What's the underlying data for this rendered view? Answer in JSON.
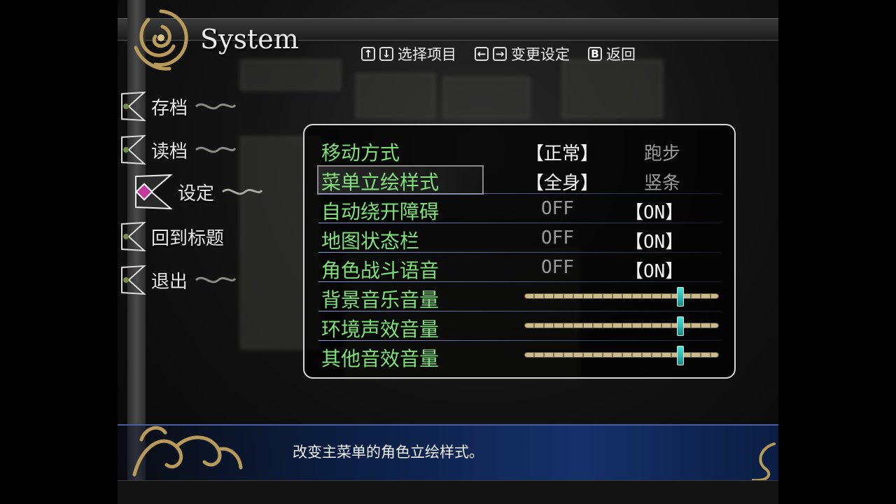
{
  "header": {
    "title": "System",
    "hints": {
      "up_key": "↑",
      "down_key": "↓",
      "select_label": "选择项目",
      "left_key": "←",
      "right_key": "→",
      "change_label": "变更设定",
      "back_key": "B",
      "back_label": "返回"
    }
  },
  "menu": {
    "items": [
      {
        "label": "存档"
      },
      {
        "label": "读档"
      },
      {
        "label": "设定",
        "selected": true
      },
      {
        "label": "回到标题"
      },
      {
        "label": "退出"
      }
    ]
  },
  "settings": {
    "rows": [
      {
        "label": "移动方式",
        "opt1": "【正常】",
        "opt2": "跑步",
        "active": "opt1"
      },
      {
        "label": "菜单立绘样式",
        "opt1": "【全身】",
        "opt2": "竖条",
        "active": "opt1",
        "selected": true
      },
      {
        "label": "自动绕开障碍",
        "opt1": "OFF",
        "opt2": "【ON】",
        "active": "opt2"
      },
      {
        "label": "地图状态栏",
        "opt1": "OFF",
        "opt2": "【ON】",
        "active": "opt2"
      },
      {
        "label": "角色战斗语音",
        "opt1": "OFF",
        "opt2": "【ON】",
        "active": "opt2"
      },
      {
        "label": "背景音乐音量",
        "slider": 0.8
      },
      {
        "label": "环境声效音量",
        "slider": 0.8
      },
      {
        "label": "其他音效音量",
        "slider": 0.8
      }
    ]
  },
  "footer": {
    "description": "改变主菜单的角色立绘样式。"
  },
  "colors": {
    "label_green": "#7fe07a",
    "slider_knob": "#2fbfb4",
    "footer_blue": "#16316a"
  }
}
